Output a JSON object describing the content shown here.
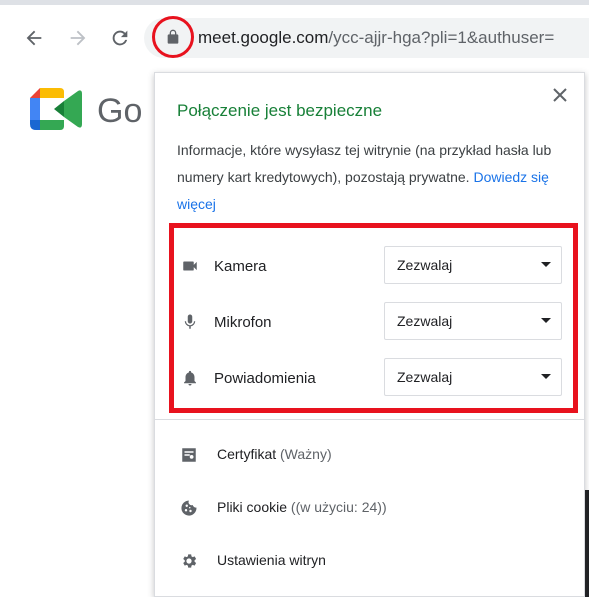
{
  "browser": {
    "url_host": "meet.google.com",
    "url_path": "/ycc-ajjr-hga?pli=1&authuser="
  },
  "page": {
    "logo_text": "Go"
  },
  "popup": {
    "title": "Połączenie jest bezpieczne",
    "description": "Informacje, które wysyłasz tej witrynie (na przykład hasła lub numery kart kredytowych), pozostają prywatne.",
    "learn_more": "Dowiedz się więcej",
    "permissions": [
      {
        "icon": "camera-icon",
        "label": "Kamera",
        "value": "Zezwalaj"
      },
      {
        "icon": "microphone-icon",
        "label": "Mikrofon",
        "value": "Zezwalaj"
      },
      {
        "icon": "bell-icon",
        "label": "Powiadomienia",
        "value": "Zezwalaj"
      }
    ],
    "menu": [
      {
        "icon": "certificate-icon",
        "label": "Certyfikat",
        "sub": "(Ważny)"
      },
      {
        "icon": "cookie-icon",
        "label": "Pliki cookie",
        "sub": "((w użyciu: 24))"
      },
      {
        "icon": "gear-icon",
        "label": "Ustawienia witryn",
        "sub": ""
      }
    ]
  },
  "colors": {
    "secure_green": "#188038",
    "link_blue": "#1a73e8",
    "highlight_red": "#e8121e"
  }
}
